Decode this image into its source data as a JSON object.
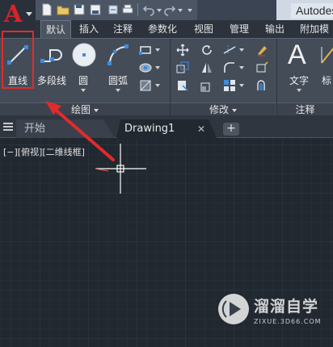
{
  "app": {
    "title": "Autodes",
    "logo_letter": "A"
  },
  "ribbon_tabs": [
    {
      "label": "默认",
      "active": true
    },
    {
      "label": "插入"
    },
    {
      "label": "注释"
    },
    {
      "label": "参数化"
    },
    {
      "label": "视图"
    },
    {
      "label": "管理"
    },
    {
      "label": "输出"
    },
    {
      "label": "附加模"
    }
  ],
  "draw_panel": {
    "title": "绘图",
    "tools": [
      {
        "label": "直线",
        "icon": "line-icon"
      },
      {
        "label": "多段线",
        "icon": "polyline-icon"
      },
      {
        "label": "圆",
        "icon": "circle-icon"
      },
      {
        "label": "圆弧",
        "icon": "arc-icon"
      }
    ]
  },
  "modify_panel": {
    "title": "修改"
  },
  "annotation_panel": {
    "title": "注释",
    "text_label": "文字",
    "text_glyph": "A",
    "dim_label": "标"
  },
  "document_tabs": [
    {
      "label": "开始"
    },
    {
      "label": "Drawing1",
      "active": true
    }
  ],
  "doc_tab_close": "✕",
  "doc_tab_add": "+",
  "viewport_label": "[−][俯视][二维线框]",
  "watermark": {
    "title": "溜溜自学",
    "subtitle": "ZIXUE.3D66.COM"
  },
  "colors": {
    "logo_red": "#d8232a",
    "highlight_red": "#e02b2b",
    "canvas": "#212830",
    "ribbon": "#444c58"
  }
}
